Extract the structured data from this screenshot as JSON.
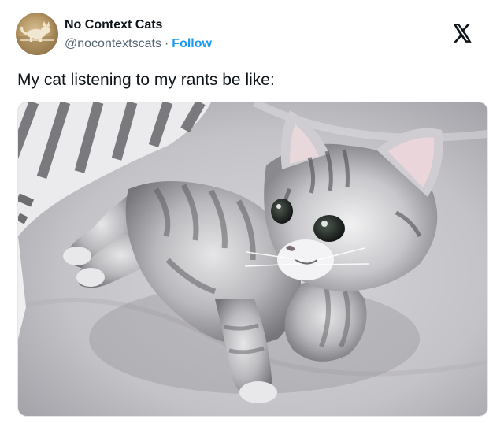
{
  "account": {
    "display_name": "No Context Cats",
    "handle": "@nocontextscats",
    "separator": "·",
    "follow_label": "Follow"
  },
  "platform": {
    "logo_icon": "x-logo-icon"
  },
  "tweet": {
    "text": "My cat listening to my rants be like:"
  },
  "media": {
    "icon": "photo-kitten-image"
  },
  "colors": {
    "accent": "#1d9bf0",
    "text_primary": "#0f1419",
    "text_secondary": "#536471"
  }
}
